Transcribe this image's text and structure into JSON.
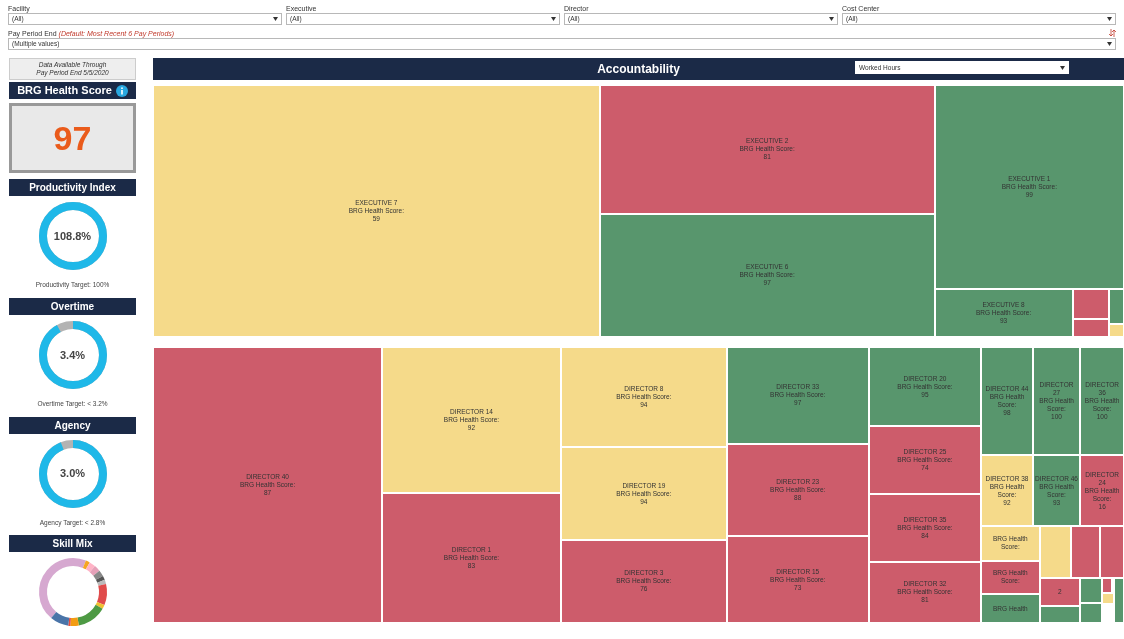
{
  "filters": [
    {
      "label": "Facility",
      "value": "(All)"
    },
    {
      "label": "Executive",
      "value": "(All)"
    },
    {
      "label": "Director",
      "value": "(All)"
    },
    {
      "label": "Cost Center",
      "value": "(All)"
    }
  ],
  "pay_period": {
    "label": "Pay Period End",
    "hint": "(Default: Most Recent 6 Pay Periods)",
    "value": "(Multiple values)"
  },
  "sidebar": {
    "data_note": [
      "Data Available Through",
      "Pay Period End 5/5/2020"
    ],
    "score_title": "BRG Health Score",
    "score": "97",
    "gauges": [
      {
        "title": "Productivity Index",
        "reading": "108.8%",
        "level": 1,
        "target": "Productivity Target: 100%"
      },
      {
        "title": "Overtime",
        "reading": "3.4%",
        "level": 0.92,
        "target": "Overtime Target: < 3.2%"
      },
      {
        "title": "Agency",
        "reading": "3.0%",
        "level": 0.94,
        "target": "Agency Target: < 2.8%"
      }
    ],
    "skill_mix_title": "Skill Mix"
  },
  "accountability": {
    "title": "Accountability",
    "measure": "Worked Hours",
    "executives": [
      {
        "lines": [
          "EXECUTIVE 7",
          "BRG Health Score:",
          "59"
        ],
        "color": "#f5da8a"
      },
      {
        "lines": [
          "EXECUTIVE 2",
          "BRG Health Score:",
          "81"
        ],
        "color": "#cd5c6b"
      },
      {
        "lines": [
          "EXECUTIVE 6",
          "BRG Health Score:",
          "97"
        ],
        "color": "#58966d"
      },
      {
        "lines": [
          "EXECUTIVE 1",
          "BRG Health Score:",
          "99"
        ],
        "color": "#58966d"
      },
      {
        "lines": [
          "EXECUTIVE 8",
          "BRG Health Score:",
          "93"
        ],
        "color": "#58966d"
      },
      {
        "color": "#cd5c6b"
      },
      {
        "color": "#cd5c6b"
      },
      {
        "color": "#58966d"
      },
      {
        "color": "#f5da8a"
      }
    ],
    "directors": [
      {
        "lines": [
          "DIRECTOR 40",
          "BRG Health Score:",
          "87"
        ],
        "color": "#cd5c6b"
      },
      {
        "lines": [
          "DIRECTOR 14",
          "BRG Health Score:",
          "92"
        ],
        "color": "#f5da8a"
      },
      {
        "lines": [
          "DIRECTOR 1",
          "BRG Health Score:",
          "83"
        ],
        "color": "#cd5c6b"
      },
      {
        "lines": [
          "DIRECTOR 8",
          "BRG Health Score:",
          "94"
        ],
        "color": "#f5da8a"
      },
      {
        "lines": [
          "DIRECTOR 19",
          "BRG Health Score:",
          "94"
        ],
        "color": "#f5da8a"
      },
      {
        "lines": [
          "DIRECTOR 3",
          "BRG Health Score:",
          "76"
        ],
        "color": "#cd5c6b"
      },
      {
        "lines": [
          "DIRECTOR 33",
          "BRG Health Score:",
          "97"
        ],
        "color": "#58966d"
      },
      {
        "lines": [
          "DIRECTOR 23",
          "BRG Health Score:",
          "88"
        ],
        "color": "#cd5c6b"
      },
      {
        "lines": [
          "DIRECTOR 15",
          "BRG Health Score:",
          "73"
        ],
        "color": "#cd5c6b"
      },
      {
        "lines": [
          "DIRECTOR 20",
          "BRG Health Score:",
          "95"
        ],
        "color": "#58966d"
      },
      {
        "lines": [
          "DIRECTOR 25",
          "BRG Health Score:",
          "74"
        ],
        "color": "#cd5c6b"
      },
      {
        "lines": [
          "DIRECTOR 35",
          "BRG Health Score:",
          "84"
        ],
        "color": "#cd5c6b"
      },
      {
        "lines": [
          "DIRECTOR 32",
          "BRG Health Score:",
          "81"
        ],
        "color": "#cd5c6b"
      },
      {
        "lines": [
          "DIRECTOR 44",
          "BRG Health",
          "Score:",
          "98"
        ],
        "color": "#58966d"
      },
      {
        "lines": [
          "DIRECTOR",
          "27",
          "BRG Health",
          "Score:",
          "100"
        ],
        "color": "#58966d"
      },
      {
        "lines": [
          "DIRECTOR",
          "36",
          "BRG Health",
          "Score:",
          "100"
        ],
        "color": "#58966d"
      },
      {
        "lines": [
          "DIRECTOR 38",
          "BRG Health",
          "Score:",
          "92"
        ],
        "color": "#f5da8a"
      },
      {
        "lines": [
          "DIRECTOR 46",
          "BRG Health",
          "Score:",
          "93"
        ],
        "color": "#58966d"
      },
      {
        "lines": [
          "DIRECTOR",
          "24",
          "BRG Health",
          "Score:",
          "16"
        ],
        "color": "#cd5c6b"
      },
      {
        "lines": [
          "BRG Health",
          "Score:"
        ],
        "color": "#f5da8a"
      },
      {
        "lines": [
          "BRG Health",
          "Score:"
        ],
        "color": "#cd5c6b"
      },
      {
        "lines": [
          "BRG Health"
        ],
        "color": "#58966d"
      },
      {
        "color": "#f5da8a"
      },
      {
        "color": "#cd5c6b"
      },
      {
        "color": "#cd5c6b"
      },
      {
        "lines": [
          "2"
        ],
        "color": "#cd5c6b"
      },
      {
        "color": "#58966d"
      },
      {
        "color": "#58966d"
      },
      {
        "color": "#58966d"
      },
      {
        "color": "#cd5c6b"
      },
      {
        "color": "#f5da8a"
      },
      {
        "color": "#58966d"
      }
    ]
  }
}
